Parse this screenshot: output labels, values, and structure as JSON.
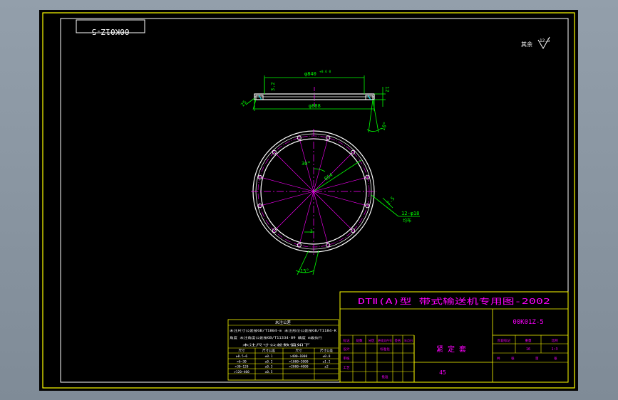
{
  "viewer": {
    "background": "#8e9aa6",
    "sheet_color": "#000000"
  },
  "colors": {
    "frame": "#ffff00",
    "part": "#ffffff",
    "dim": "#00ff00",
    "center": "#ff00ff",
    "text": "#ff00ff"
  },
  "corner_tag": "00K01Z-5",
  "surface_note": {
    "label": "其余",
    "value": "12.5"
  },
  "part_dims": {
    "top_dia": "φ840",
    "top_dia_tol": "+0.6 0",
    "bottom_dia": "φ888",
    "thickness": "12",
    "left_chamfer": "3.2",
    "left_angle": "25",
    "right_angle": "10°"
  },
  "circle_dims": {
    "angle_30": "30°",
    "pcd": "864",
    "holes": "12-φ18",
    "holes_note": "均布",
    "r_small": "2.5",
    "angle_15": "15°",
    "mark_3": "3"
  },
  "title_block": {
    "title": "DTⅡ(A)型  带式输送机专用图-2002",
    "drawing_no": "00K01Z-5",
    "part_name": "紧  定  套",
    "material": "45",
    "headers": [
      "标记",
      "处数",
      "分区",
      "更改文件号",
      "签名",
      "年月日"
    ],
    "rows_left": [
      "设计",
      "审核",
      "工艺"
    ],
    "mid_labels": [
      "标准化",
      "批准"
    ],
    "stage_labels": [
      "阶段标记",
      "重量",
      "比例"
    ],
    "scale": "1:3",
    "weight": "16",
    "sheet_labels": [
      "共",
      "张",
      "第",
      "张"
    ]
  },
  "tolerance_table": {
    "title": "未注公差",
    "notes": [
      "未注尺寸公差按GB/T1804-m 未注形位公差按GB/T1184-K",
      "角度 未注角度公差按GB/T11334-89 精度 m级执行",
      "未注尺寸公差数值如下"
    ],
    "header": [
      "尺寸",
      "尺寸公差",
      "尺寸",
      "尺寸公差"
    ],
    "rows": [
      [
        "≥0.5~6",
        "±0.1",
        ">400~1000",
        "±0.8"
      ],
      [
        ">6~30",
        "±0.2",
        ">1000~2000",
        "±1.2"
      ],
      [
        ">30~120",
        "±0.3",
        ">2000~4000",
        "±2"
      ],
      [
        ">120~400",
        "±0.5",
        "",
        ""
      ]
    ]
  }
}
